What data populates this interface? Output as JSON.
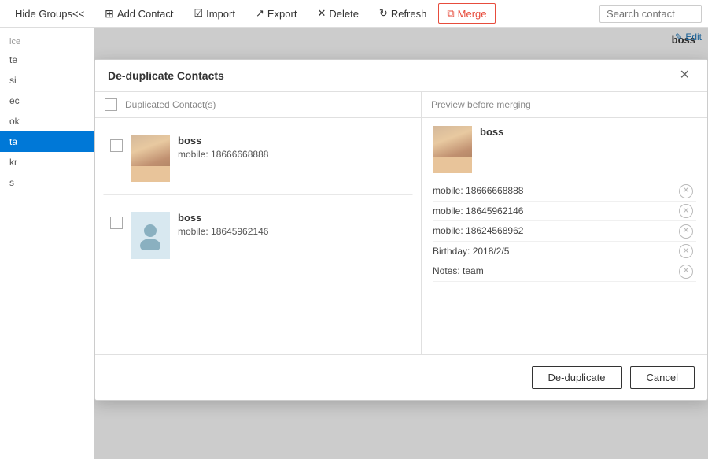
{
  "toolbar": {
    "hide_groups_label": "Hide Groups<<",
    "add_contact_label": "Add Contact",
    "import_label": "Import",
    "export_label": "Export",
    "delete_label": "Delete",
    "refresh_label": "Refresh",
    "merge_label": "Merge",
    "search_placeholder": "Search contact"
  },
  "background": {
    "boss_label": "boss",
    "edit_label": "Edit",
    "sidebar_items": [
      "te",
      "si",
      "ec",
      "ok",
      "ta",
      "kr",
      "s"
    ]
  },
  "modal": {
    "title": "De-duplicate Contacts",
    "col_left_header": "Duplicated Contact(s)",
    "col_right_header": "Preview before merging",
    "contacts": [
      {
        "name": "boss",
        "detail": "mobile: 18666668888",
        "has_photo": true
      },
      {
        "name": "boss",
        "detail": "mobile: 18645962146",
        "has_photo": false
      }
    ],
    "preview": {
      "name": "boss",
      "fields": [
        "mobile: 18666668888",
        "mobile: 18645962146",
        "mobile: 18624568962",
        "Birthday: 2018/2/5",
        "Notes: team"
      ]
    },
    "footer": {
      "dedup_label": "De-duplicate",
      "cancel_label": "Cancel"
    }
  }
}
